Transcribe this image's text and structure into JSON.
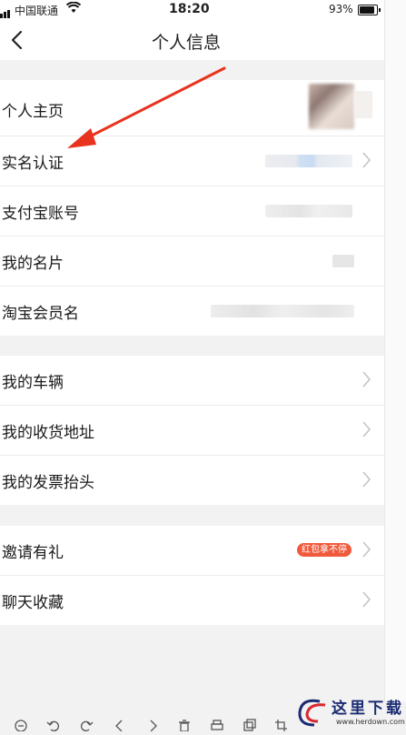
{
  "status_bar": {
    "carrier": "中国联通",
    "time": "18:20",
    "battery": "93%"
  },
  "nav": {
    "title": "个人信息"
  },
  "section1": {
    "items": [
      {
        "label": "个人主页"
      },
      {
        "label": "实名认证"
      },
      {
        "label": "支付宝账号"
      },
      {
        "label": "我的名片"
      },
      {
        "label": "淘宝会员名"
      }
    ]
  },
  "section2": {
    "items": [
      {
        "label": "我的车辆"
      },
      {
        "label": "我的收货地址"
      },
      {
        "label": "我的发票抬头"
      }
    ]
  },
  "section3": {
    "items": [
      {
        "label": "邀请有礼",
        "badge": "红包拿不停"
      },
      {
        "label": "聊天收藏"
      }
    ]
  },
  "watermark": {
    "title": "这里下载",
    "url": "www.herdown.com"
  },
  "colors": {
    "accent": "#f05a3c",
    "arrow": "#e8331f",
    "background": "#f2f2f2"
  },
  "icons": [
    "back-icon",
    "chevron-right-icon",
    "zoom-out-icon",
    "rotate-left-icon",
    "rotate-right-icon",
    "prev-icon",
    "next-icon",
    "delete-icon",
    "print-icon",
    "copy-icon",
    "crop-icon"
  ]
}
